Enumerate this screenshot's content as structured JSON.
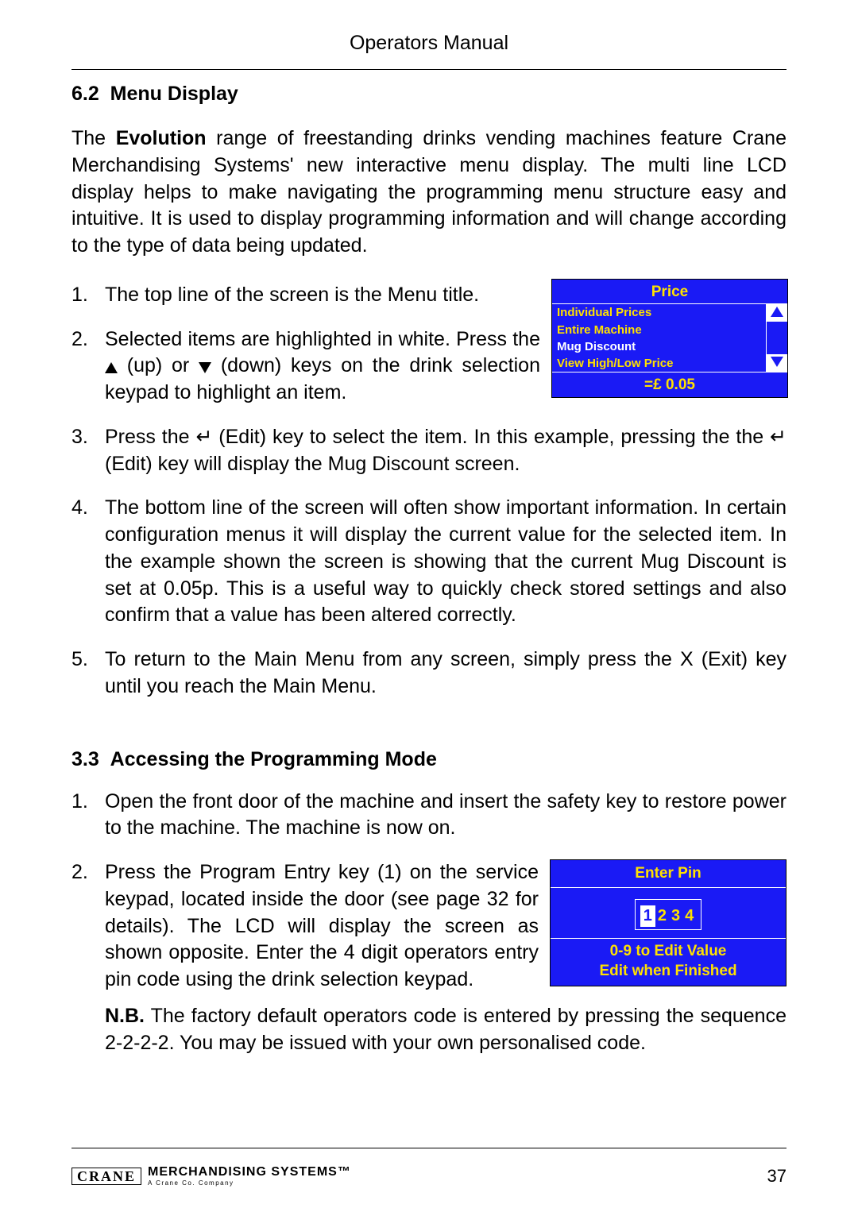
{
  "header": "Operators Manual",
  "section62": {
    "number": "6.2",
    "title": "Menu Display",
    "intro_pre": "The ",
    "intro_bold": "Evolution",
    "intro_post": " range of freestanding drinks vending machines feature Crane Merchandising Systems' new interactive menu display. The multi line LCD display helps to make navigating the programming menu structure easy and intuitive. It is used to display programming information and will change according to the type of data being updated.",
    "steps": {
      "s1": "The top line of the screen is the Menu title.",
      "s2a": "Selected items are highlighted in white. Press the ",
      "s2b": " (up) or ",
      "s2c": " (down) keys on the drink selection keypad to highlight an item.",
      "s3": "Press the ↵ (Edit) key to select the item. In this example, pressing the the ↵ (Edit) key will display the Mug Discount screen.",
      "s4": "The bottom line of the screen will often show important information. In certain configuration menus it will display the current value for the selected item. In the example shown the screen is showing that the current Mug Discount is set at 0.05p. This is a useful way to quickly check stored settings and also confirm that a value has been altered correctly.",
      "s5": "To return to the Main Menu from any screen, simply press the X (Exit) key until you reach the Main Menu."
    }
  },
  "lcd1": {
    "title": "Price",
    "items": [
      {
        "label": "Individual Prices",
        "white": false
      },
      {
        "label": "Entire Machine",
        "white": false
      },
      {
        "label": "Mug Discount",
        "white": true
      },
      {
        "label": "View High/Low Price",
        "white": false
      }
    ],
    "footer": "=£ 0.05"
  },
  "section33": {
    "number": "3.3",
    "title": "Accessing the Programming Mode",
    "steps": {
      "s1": "Open the front door of the machine and insert the safety key to restore power to the machine. The machine is now on.",
      "s2": "Press the Program Entry key (1) on the service keypad, located inside the door (see page 32 for details). The LCD will display the screen as shown opposite. Enter the 4 digit operators entry pin code using the drink selection keypad.",
      "nb_label": "N.B.",
      "nb_text": "  The factory default operators code is entered by pressing the sequence 2-2-2-2. You may be issued with your own personalised code."
    }
  },
  "lcd2": {
    "title": "Enter Pin",
    "digits": [
      "1",
      "2",
      "3",
      "4"
    ],
    "footer1": "0-9 to Edit Value",
    "footer2": "Edit when Finished"
  },
  "footer": {
    "brand_box": "CRANE",
    "brand_text": "MERCHANDISING SYSTEMS™",
    "brand_sub": "A Crane Co. Company",
    "page_num": "37"
  }
}
